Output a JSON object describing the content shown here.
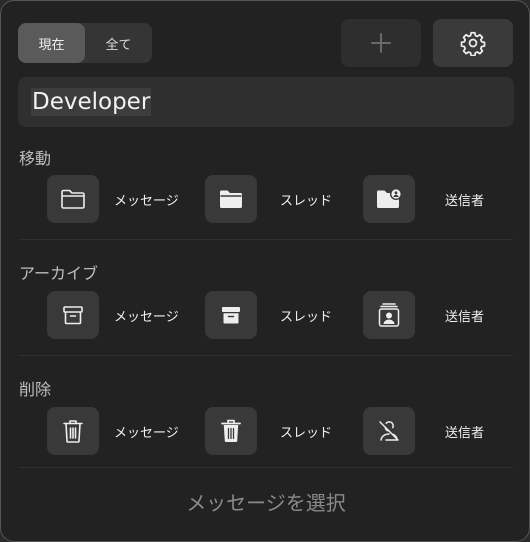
{
  "tabs": {
    "current": "現在",
    "all": "全て"
  },
  "search": {
    "value": "Developer"
  },
  "sections": {
    "move": {
      "title": "移動",
      "message": "メッセージ",
      "thread": "スレッド",
      "sender": "送信者"
    },
    "archive": {
      "title": "アーカイブ",
      "message": "メッセージ",
      "thread": "スレッド",
      "sender": "送信者"
    },
    "delete": {
      "title": "削除",
      "message": "メッセージ",
      "thread": "スレッド",
      "sender": "送信者"
    }
  },
  "footer": {
    "label": "メッセージを選択"
  },
  "icons": {
    "add": "plus-icon",
    "settings": "gear-icon",
    "move": [
      "folder-outline-icon",
      "folder-filled-icon",
      "folder-person-icon"
    ],
    "archive": [
      "archive-outline-icon",
      "archive-filled-icon",
      "contact-card-icon"
    ],
    "delete": [
      "trash-outline-icon",
      "trash-filled-icon",
      "person-slash-icon"
    ]
  },
  "colors": {
    "background": "#222222",
    "button": "#393939",
    "active_tab": "#5a5a5a"
  }
}
